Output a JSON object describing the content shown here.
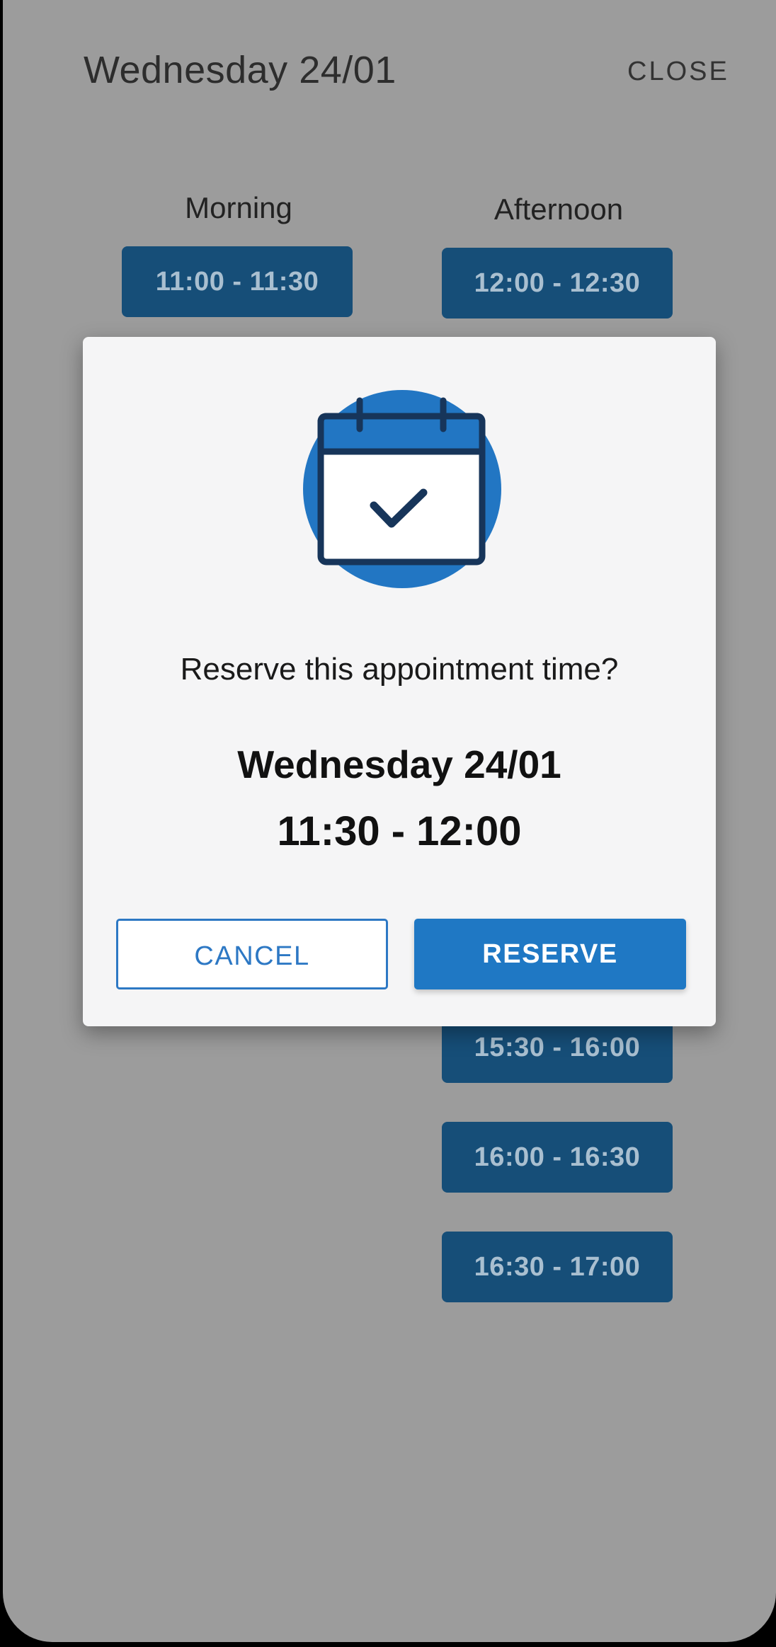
{
  "header": {
    "title": "Wednesday 24/01",
    "close_label": "CLOSE"
  },
  "columns": {
    "morning_label": "Morning",
    "afternoon_label": "Afternoon"
  },
  "slots": {
    "morning": [
      "11:00 - 11:30"
    ],
    "afternoon": [
      "12:00 - 12:30",
      "15:30 - 16:00",
      "16:00 - 16:30",
      "16:30 - 17:00"
    ]
  },
  "dialog": {
    "icon": "calendar-check-icon",
    "question": "Reserve this appointment time?",
    "date": "Wednesday 24/01",
    "time": "11:30 - 12:00",
    "cancel_label": "CANCEL",
    "reserve_label": "RESERVE"
  },
  "colors": {
    "accent": "#1f78c4",
    "slot_bg": "#164e78",
    "overlay_bg": "#9c9c9c",
    "dialog_bg": "#f5f5f6"
  }
}
